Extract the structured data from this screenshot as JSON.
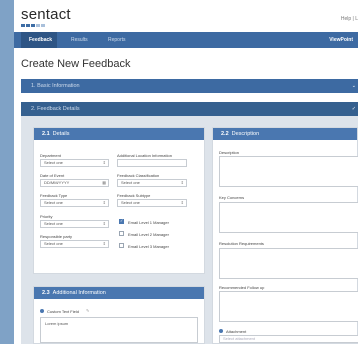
{
  "brand": {
    "name": "sentact"
  },
  "header": {
    "help": "Help | L"
  },
  "nav": {
    "tabs": [
      "Feedback",
      "Results",
      "Reports"
    ],
    "right": "ViewPoint"
  },
  "page": {
    "title": "Create New Feedback"
  },
  "sections": [
    {
      "num": "1.",
      "label": "Basic Information"
    },
    {
      "num": "2.",
      "label": "Feedback Details"
    }
  ],
  "details": {
    "num": "2.1",
    "title": "Details",
    "department": {
      "label": "Department",
      "value": "Select one"
    },
    "additional_location": {
      "label": "Additional Location Information",
      "value": ""
    },
    "date_of_event": {
      "label": "Date of Event",
      "value": "DD/MM/YYYY"
    },
    "classification": {
      "label": "Feedback Classification",
      "value": "Select one"
    },
    "feedback_type": {
      "label": "Feedback Type",
      "value": "Select one"
    },
    "subtype": {
      "label": "Feedback Subtype",
      "value": "Select one"
    },
    "priority": {
      "label": "Priority",
      "value": "Select one"
    },
    "responsible": {
      "label": "Responsible party",
      "value": "Select one"
    },
    "emails": [
      {
        "label": "Email Level 1 Manager",
        "checked": true
      },
      {
        "label": "Email Level 2 Manager",
        "checked": false
      },
      {
        "label": "Email Level 3 Manager",
        "checked": false
      }
    ]
  },
  "description": {
    "num": "2.2",
    "title": "Description",
    "fields": [
      "Description",
      "Key Concerns",
      "Resolution Requirements",
      "Recommended Follow up"
    ],
    "attachment": {
      "label": "Attachment",
      "placeholder": "Select attachment"
    }
  },
  "additional": {
    "num": "2.3",
    "title": "Additional Information",
    "custom_label": "Custom Text Field",
    "custom_value": "Lorem ipsum"
  }
}
